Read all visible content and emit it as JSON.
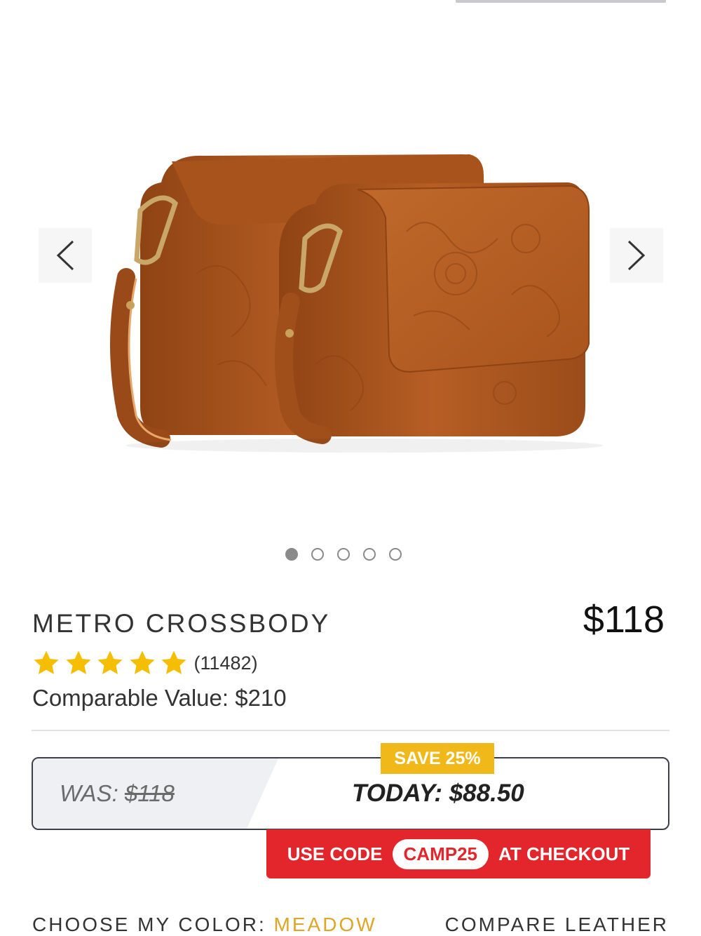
{
  "product": {
    "title": "METRO CROSSBODY",
    "price": "$118",
    "rating_stars": 5,
    "review_count": "(11482)",
    "comparable_value": "Comparable Value: $210"
  },
  "carousel": {
    "slide_count": 5,
    "active_index": 0
  },
  "deal": {
    "badge": "SAVE 25%",
    "was_label": "WAS: ",
    "was_price": "$118",
    "today": "TODAY: $88.50"
  },
  "promo": {
    "prefix": "USE CODE",
    "code": "CAMP25",
    "suffix": "AT CHECKOUT"
  },
  "options": {
    "choose_color_label": "CHOOSE MY COLOR: ",
    "color_name": "MEADOW",
    "compare_link": "COMPARE LEATHER"
  },
  "colors": {
    "star": "#f6be00",
    "badge": "#f1b81a",
    "promo_red": "#e3262c",
    "color_name": "#e0a526",
    "leather": "#b25e23"
  }
}
